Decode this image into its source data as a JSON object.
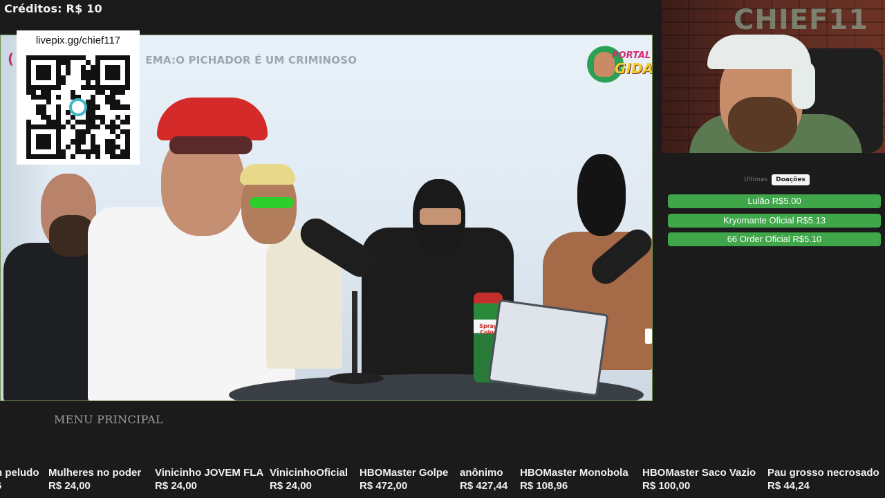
{
  "credits": "Créditos: R$ 10",
  "video": {
    "topic": "EMA:O PICHADOR É UM CRIMINOSO",
    "paren": "(",
    "channel_line1": "PORTAL",
    "channel_line2": "GIDA",
    "spray_label": "Spray Color"
  },
  "qr": {
    "url": "livepix.gg/chief117"
  },
  "webcam": {
    "wall_logo": "CHIEF11"
  },
  "donations": {
    "tabs": [
      "Últimas",
      "Doações"
    ],
    "active_tab": "Doações",
    "items": [
      {
        "label": "Lulão R$5.00"
      },
      {
        "label": "Kryomante Oficial R$5.13"
      },
      {
        "label": "66 Order Oficial R$5.10"
      }
    ]
  },
  "menu_label": "MENU PRINCIPAL",
  "ticker": [
    {
      "name": "n peludo",
      "amount": "6"
    },
    {
      "name": "Mulheres no poder",
      "amount": "R$ 24,00"
    },
    {
      "name": "Vinicinho JOVEM FLA",
      "amount": "R$ 24,00"
    },
    {
      "name": "VinicinhoOficial",
      "amount": "R$ 24,00"
    },
    {
      "name": "HBOMaster Golpe",
      "amount": "R$ 472,00"
    },
    {
      "name": "anônimo",
      "amount": "R$ 427,44"
    },
    {
      "name": "HBOMaster Monobola",
      "amount": "R$ 108,96"
    },
    {
      "name": "HBOMaster Saco Vazio",
      "amount": "R$ 100,00"
    },
    {
      "name": "Pau grosso necrosado",
      "amount": "R$ 44,24"
    }
  ],
  "colors": {
    "donation_green": "#3fa64a",
    "video_border": "#6f8f4a",
    "background": "#1b1b1b"
  }
}
